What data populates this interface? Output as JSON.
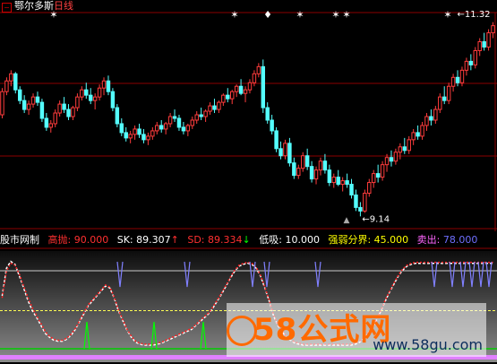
{
  "header": {
    "mark": "−",
    "stock_name": "鄂尔多斯",
    "period": "日线"
  },
  "price_panel": {
    "high_label": "11.32",
    "low_label": "9.14"
  },
  "indicator_bar": {
    "name": "股市网制",
    "high_throw_label": "高抛:",
    "high_throw_value": "90.000",
    "sk_label": "SK:",
    "sk_value": "89.307",
    "sk_arrow": "↑",
    "sd_label": "SD:",
    "sd_value": "89.334",
    "sd_arrow": "↓",
    "low_buy_label": "低吸:",
    "low_buy_value": "10.000",
    "boundary_label": "强弱分界:",
    "boundary_value": "45.000",
    "sell_label": "卖出:",
    "sell_value": "78.000"
  },
  "colors": {
    "up": "#ff3c3c",
    "down": "#54ffff",
    "gridline": "#8b0000",
    "sk_line": "#ffffff",
    "sd_line": "#ff2020",
    "high_line": "#ffff55",
    "low_line": "#00cc00",
    "spikes_buy": "#00ff00",
    "spikes_sell": "#8080ff",
    "bottom_band": "#e080ff",
    "sk_label_color": "#ffffff",
    "sd_label_color": "#ff3030",
    "low_buy_color": "#ffffff",
    "boundary_color": "#ffff00",
    "sell_color": "#ff66ff",
    "high_throw_color": "#ff3030"
  },
  "watermark": {
    "brand": "58公式网",
    "url": "www.58gu.com"
  },
  "chart_data": [
    {
      "type": "candlestick",
      "title": "鄂尔多斯 日线",
      "annotations": [
        "11.32",
        "9.14"
      ],
      "ohlc": [
        [
          10.28,
          10.58,
          10.24,
          10.54
        ],
        [
          10.54,
          10.7,
          10.5,
          10.66
        ],
        [
          10.66,
          10.78,
          10.6,
          10.74
        ],
        [
          10.74,
          10.76,
          10.52,
          10.56
        ],
        [
          10.56,
          10.6,
          10.4,
          10.44
        ],
        [
          10.44,
          10.5,
          10.3,
          10.34
        ],
        [
          10.34,
          10.44,
          10.28,
          10.4
        ],
        [
          10.4,
          10.52,
          10.36,
          10.48
        ],
        [
          10.48,
          10.54,
          10.38,
          10.42
        ],
        [
          10.42,
          10.46,
          10.2,
          10.24
        ],
        [
          10.24,
          10.3,
          10.1,
          10.14
        ],
        [
          10.14,
          10.22,
          10.08,
          10.18
        ],
        [
          10.18,
          10.34,
          10.14,
          10.3
        ],
        [
          10.3,
          10.44,
          10.26,
          10.4
        ],
        [
          10.4,
          10.48,
          10.3,
          10.34
        ],
        [
          10.34,
          10.4,
          10.22,
          10.26
        ],
        [
          10.26,
          10.38,
          10.22,
          10.36
        ],
        [
          10.36,
          10.52,
          10.32,
          10.48
        ],
        [
          10.48,
          10.6,
          10.44,
          10.56
        ],
        [
          10.56,
          10.64,
          10.46,
          10.5
        ],
        [
          10.5,
          10.58,
          10.4,
          10.44
        ],
        [
          10.44,
          10.52,
          10.34,
          10.48
        ],
        [
          10.48,
          10.62,
          10.44,
          10.58
        ],
        [
          10.58,
          10.7,
          10.5,
          10.66
        ],
        [
          10.66,
          10.72,
          10.5,
          10.54
        ],
        [
          10.54,
          10.58,
          10.32,
          10.36
        ],
        [
          10.36,
          10.4,
          10.14,
          10.18
        ],
        [
          10.18,
          10.24,
          10.04,
          10.08
        ],
        [
          10.08,
          10.14,
          9.98,
          10.02
        ],
        [
          10.02,
          10.1,
          9.96,
          10.06
        ],
        [
          10.06,
          10.16,
          10.0,
          10.12
        ],
        [
          10.12,
          10.18,
          10.02,
          10.06
        ],
        [
          10.06,
          10.12,
          9.96,
          10.0
        ],
        [
          10.0,
          10.08,
          9.94,
          10.04
        ],
        [
          10.04,
          10.14,
          10.0,
          10.1
        ],
        [
          10.1,
          10.2,
          10.06,
          10.16
        ],
        [
          10.16,
          10.22,
          10.08,
          10.12
        ],
        [
          10.12,
          10.2,
          10.06,
          10.18
        ],
        [
          10.18,
          10.3,
          10.14,
          10.26
        ],
        [
          10.26,
          10.34,
          10.2,
          10.24
        ],
        [
          10.24,
          10.28,
          10.1,
          10.14
        ],
        [
          10.14,
          10.2,
          10.06,
          10.1
        ],
        [
          10.1,
          10.18,
          10.04,
          10.16
        ],
        [
          10.16,
          10.26,
          10.12,
          10.22
        ],
        [
          10.22,
          10.32,
          10.18,
          10.28
        ],
        [
          10.28,
          10.36,
          10.22,
          10.26
        ],
        [
          10.26,
          10.34,
          10.2,
          10.32
        ],
        [
          10.32,
          10.42,
          10.28,
          10.38
        ],
        [
          10.38,
          10.46,
          10.3,
          10.34
        ],
        [
          10.34,
          10.44,
          10.3,
          10.42
        ],
        [
          10.42,
          10.52,
          10.38,
          10.5
        ],
        [
          10.5,
          10.58,
          10.42,
          10.46
        ],
        [
          10.46,
          10.56,
          10.4,
          10.54
        ],
        [
          10.54,
          10.62,
          10.48,
          10.6
        ],
        [
          10.6,
          10.68,
          10.5,
          10.52
        ],
        [
          10.52,
          10.6,
          10.42,
          10.56
        ],
        [
          10.56,
          10.68,
          10.52,
          10.64
        ],
        [
          10.64,
          10.78,
          10.6,
          10.74
        ],
        [
          10.74,
          10.86,
          10.7,
          10.82
        ],
        [
          10.82,
          10.9,
          10.3,
          10.36
        ],
        [
          10.36,
          10.42,
          10.18,
          10.22
        ],
        [
          10.22,
          10.28,
          10.06,
          10.1
        ],
        [
          10.1,
          10.14,
          9.86,
          9.9
        ],
        [
          9.9,
          9.98,
          9.78,
          9.82
        ],
        [
          9.82,
          10.0,
          9.78,
          9.96
        ],
        [
          9.96,
          10.02,
          9.7,
          9.74
        ],
        [
          9.74,
          9.8,
          9.56,
          9.6
        ],
        [
          9.6,
          9.72,
          9.56,
          9.68
        ],
        [
          9.68,
          9.86,
          9.64,
          9.82
        ],
        [
          9.82,
          9.9,
          9.66,
          9.7
        ],
        [
          9.7,
          9.76,
          9.52,
          9.56
        ],
        [
          9.56,
          9.7,
          9.5,
          9.66
        ],
        [
          9.66,
          9.8,
          9.6,
          9.76
        ],
        [
          9.76,
          9.84,
          9.62,
          9.66
        ],
        [
          9.66,
          9.72,
          9.48,
          9.52
        ],
        [
          9.52,
          9.62,
          9.46,
          9.58
        ],
        [
          9.58,
          9.66,
          9.48,
          9.5
        ],
        [
          9.5,
          9.58,
          9.42,
          9.54
        ],
        [
          9.54,
          9.62,
          9.46,
          9.5
        ],
        [
          9.5,
          9.56,
          9.34,
          9.38
        ],
        [
          9.38,
          9.44,
          9.2,
          9.24
        ],
        [
          9.24,
          9.3,
          9.14,
          9.2
        ],
        [
          9.2,
          9.44,
          9.18,
          9.4
        ],
        [
          9.4,
          9.56,
          9.36,
          9.52
        ],
        [
          9.52,
          9.66,
          9.46,
          9.62
        ],
        [
          9.62,
          9.72,
          9.52,
          9.58
        ],
        [
          9.58,
          9.76,
          9.54,
          9.72
        ],
        [
          9.72,
          9.84,
          9.64,
          9.8
        ],
        [
          9.8,
          9.88,
          9.7,
          9.76
        ],
        [
          9.76,
          9.9,
          9.72,
          9.86
        ],
        [
          9.86,
          9.96,
          9.78,
          9.92
        ],
        [
          9.92,
          10.02,
          9.84,
          9.88
        ],
        [
          9.88,
          10.04,
          9.84,
          10.0
        ],
        [
          10.0,
          10.12,
          9.94,
          10.08
        ],
        [
          10.08,
          10.16,
          10.0,
          10.04
        ],
        [
          10.04,
          10.2,
          10.0,
          10.16
        ],
        [
          10.16,
          10.3,
          10.1,
          10.26
        ],
        [
          10.26,
          10.34,
          10.16,
          10.22
        ],
        [
          10.22,
          10.38,
          10.18,
          10.34
        ],
        [
          10.34,
          10.52,
          10.3,
          10.48
        ],
        [
          10.48,
          10.6,
          10.4,
          10.44
        ],
        [
          10.44,
          10.64,
          10.4,
          10.6
        ],
        [
          10.6,
          10.74,
          10.54,
          10.7
        ],
        [
          10.7,
          10.78,
          10.6,
          10.64
        ],
        [
          10.64,
          10.82,
          10.6,
          10.78
        ],
        [
          10.78,
          10.92,
          10.72,
          10.88
        ],
        [
          10.88,
          10.96,
          10.78,
          10.84
        ],
        [
          10.84,
          11.04,
          10.8,
          11.0
        ],
        [
          11.0,
          11.14,
          10.94,
          11.1
        ],
        [
          11.1,
          11.2,
          11.0,
          11.04
        ],
        [
          11.04,
          11.24,
          11.0,
          11.2
        ],
        [
          11.2,
          11.32,
          11.14,
          11.28
        ]
      ]
    },
    {
      "type": "line",
      "title": "股市网制",
      "series": [
        {
          "name": "SK",
          "values": [
            60,
            88,
            95,
            92,
            80,
            68,
            55,
            45,
            38,
            30,
            22,
            18,
            15,
            14,
            14,
            16,
            20,
            26,
            34,
            42,
            50,
            55,
            60,
            65,
            70,
            68,
            58,
            45,
            35,
            25,
            18,
            13,
            11,
            10,
            10,
            10,
            11,
            12,
            14,
            16,
            18,
            20,
            22,
            24,
            26,
            30,
            34,
            38,
            42,
            48,
            55,
            62,
            70,
            78,
            85,
            90,
            92,
            93,
            92,
            88,
            80,
            68,
            55,
            40,
            30,
            24,
            18,
            15,
            12,
            11,
            10,
            10,
            10,
            10,
            10,
            10,
            10,
            10,
            10,
            10,
            10,
            10,
            11,
            13,
            17,
            22,
            28,
            36,
            45,
            55,
            64,
            72,
            80,
            86,
            90,
            92,
            93,
            93,
            93,
            93,
            93,
            93,
            93,
            93,
            93,
            93,
            93,
            93,
            93,
            93,
            93,
            93,
            93,
            93,
            93
          ]
        },
        {
          "name": "SD",
          "values": [
            58,
            85,
            93,
            91,
            82,
            70,
            58,
            48,
            40,
            32,
            24,
            19,
            16,
            15,
            15,
            17,
            21,
            27,
            35,
            43,
            51,
            56,
            61,
            66,
            71,
            69,
            59,
            46,
            36,
            26,
            19,
            14,
            12,
            11,
            11,
            11,
            12,
            13,
            15,
            17,
            19,
            21,
            23,
            25,
            27,
            31,
            35,
            39,
            43,
            49,
            56,
            63,
            71,
            79,
            86,
            91,
            93,
            94,
            93,
            89,
            81,
            69,
            56,
            41,
            31,
            25,
            19,
            16,
            13,
            12,
            11,
            11,
            11,
            11,
            11,
            11,
            11,
            11,
            11,
            11,
            11,
            11,
            12,
            14,
            18,
            23,
            29,
            37,
            46,
            56,
            65,
            73,
            81,
            87,
            91,
            93,
            94,
            94,
            94,
            94,
            94,
            94,
            94,
            94,
            94,
            94,
            94,
            94,
            94,
            94,
            94,
            94,
            94,
            94,
            94
          ]
        }
      ],
      "reference_lines": {
        "high_throw": 90,
        "boundary": 45,
        "sell": 78,
        "low_buy": 10
      },
      "ylim": [
        0,
        100
      ]
    }
  ]
}
